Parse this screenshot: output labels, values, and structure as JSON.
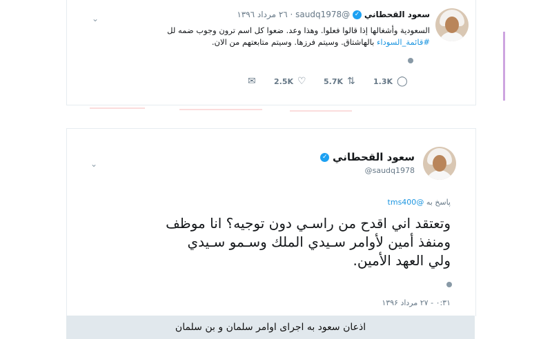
{
  "tweet1": {
    "name": "سعود القحطاني",
    "handle": "@saudq1978",
    "date": "٢٦ مرداد ١٣٩٦",
    "text_line1": "السعودية وأشغالها إذا قالوا فعلوا.  وهذا وعد. ضعوا كل اسم ترون وجوب ضمه لل",
    "text_hashtag": "#قائمة_السوداء",
    "text_line2_rest": "بالهاشتاق.  وسيتم فرزها. وسيتم متابعتهم من الان.",
    "replies": "1.3K",
    "retweets": "5.7K",
    "likes": "2.5K"
  },
  "tweet2": {
    "name": "سعود القحطاني",
    "handle": "@saudq1978",
    "reply_prefix": "پاسخ به",
    "reply_handle": "@tms400",
    "body_line1": "وتعتقد اني اقدح من راسـي دون توجيه؟ انا موظف",
    "body_line2": "ومنفذ أمين لأوامر سـيدي الملك وسـمو  سـيدي",
    "body_line3": "ولي العهد الأمين.",
    "timestamp": "۰:۳۱ - ۲۷ مرداد ۱۳۹۶"
  },
  "caption": "اذعان سعود به اجرای اوامر سلمان و بن سلمان"
}
